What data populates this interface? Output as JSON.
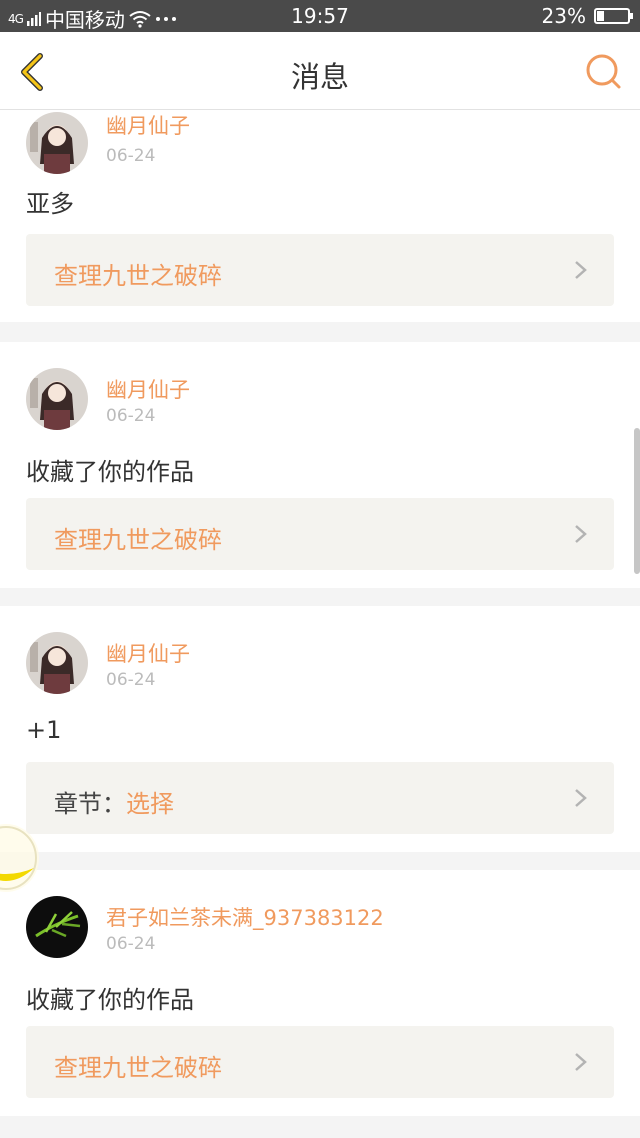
{
  "status": {
    "carrier": "中国移动",
    "signal": "4G",
    "time": "19:57",
    "battery": "23%",
    "battery_level": 0.23
  },
  "nav": {
    "title": "消息"
  },
  "messages": [
    {
      "user": "幽月仙子",
      "date": "06-24",
      "text": "亚多",
      "link_prefix": "",
      "link_text": "查理九世之破碎",
      "avatar": "girl-avatar"
    },
    {
      "user": "幽月仙子",
      "date": "06-24",
      "text": "收藏了你的作品",
      "link_prefix": "",
      "link_text": "查理九世之破碎",
      "avatar": "girl-avatar"
    },
    {
      "user": "幽月仙子",
      "date": "06-24",
      "text": "+1",
      "link_prefix": "章节：",
      "link_text": "选择",
      "avatar": "girl-avatar"
    },
    {
      "user": "君子如兰茶未满_937383122",
      "date": "06-24",
      "text": "收藏了你的作品",
      "link_prefix": "",
      "link_text": "查理九世之破碎",
      "avatar": "bamboo-avatar"
    }
  ],
  "colors": {
    "accent": "#f09a5e",
    "back_icon": "#f5c518",
    "status_bar": "#4a4a4a",
    "link_bg": "#f4f3ef"
  }
}
